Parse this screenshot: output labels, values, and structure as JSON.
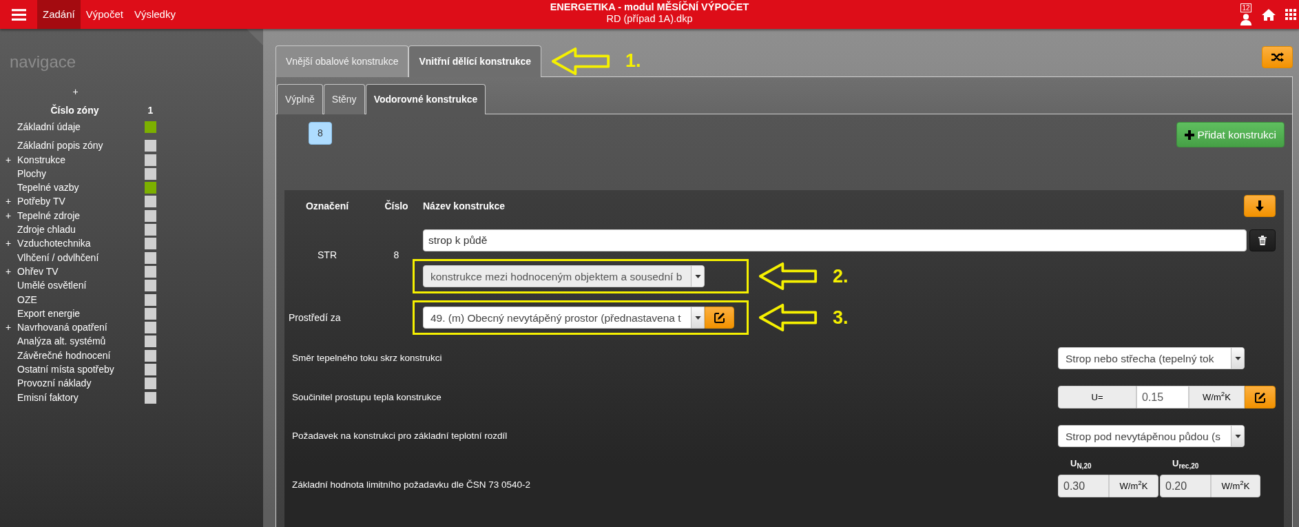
{
  "topbar": {
    "menu": [
      {
        "label": "Zadání",
        "selected": true
      },
      {
        "label": "Výpočet",
        "selected": false
      },
      {
        "label": "Výsledky",
        "selected": false
      }
    ],
    "title": "ENERGETIKA - modul MĚSÍČNÍ VÝPOČET",
    "subtitle": "RD (případ 1A).dkp",
    "notifications": "12"
  },
  "sidebar": {
    "title": "navigace",
    "add_zone": "+",
    "zone_label": "Číslo zóny",
    "zone_number": "1",
    "items": [
      {
        "label": "Základní údaje",
        "color": "#7cb000"
      },
      {
        "label": "Základní popis zóny",
        "color": "#d0d0d0"
      },
      {
        "prefix": "+",
        "label": "Konstrukce",
        "color": "#d0d0d0"
      },
      {
        "label": "Plochy",
        "color": "#d0d0d0"
      },
      {
        "label": "Tepelné vazby",
        "color": "#7cb000"
      },
      {
        "prefix": "+",
        "label": "Potřeby TV",
        "color": "#d0d0d0"
      },
      {
        "prefix": "+",
        "label": "Tepelné zdroje",
        "color": "#d0d0d0"
      },
      {
        "label": "Zdroje chladu",
        "color": "#d0d0d0"
      },
      {
        "prefix": "+",
        "label": "Vzduchotechnika",
        "color": "#d0d0d0"
      },
      {
        "label": "Vlhčení / odvlhčení",
        "color": "#d0d0d0"
      },
      {
        "prefix": "+",
        "label": "Ohřev TV",
        "color": "#d0d0d0"
      },
      {
        "label": "Umělé osvětlení",
        "color": "#d0d0d0"
      },
      {
        "label": "OZE",
        "color": "#d0d0d0"
      },
      {
        "label": "Export energie",
        "color": "#d0d0d0"
      },
      {
        "prefix": "+",
        "label": "Navrhovaná opatření",
        "color": "#d0d0d0"
      },
      {
        "label": "Analýza alt. systémů",
        "color": "#d0d0d0"
      },
      {
        "label": "Závěrečné hodnocení",
        "color": "#d0d0d0"
      },
      {
        "label": "Ostatní místa spotřeby",
        "color": "#d0d0d0"
      },
      {
        "label": "Provozní náklady",
        "color": "#d0d0d0"
      },
      {
        "label": "Emisní faktory",
        "color": "#d0d0d0"
      }
    ]
  },
  "outer_tabs": {
    "tabs": [
      {
        "label": "Vnější obalové konstrukce",
        "selected": false
      },
      {
        "label": "Vnitřní dělící konstrukce",
        "selected": true
      }
    ],
    "annotation": "1."
  },
  "inner_tabs": [
    {
      "label": "Výplně",
      "selected": false
    },
    {
      "label": "Stěny",
      "selected": false
    },
    {
      "label": "Vodorovné konstrukce",
      "selected": true
    }
  ],
  "construction_count": "8",
  "add_button": "Přidat konstrukci",
  "table": {
    "columns": [
      "Označení",
      "Číslo",
      "Název konstrukce"
    ],
    "code": "STR",
    "number": "8",
    "name": "strop k půdě",
    "type_select": {
      "value": "konstrukce mezi hodnoceným objektem a sousední b",
      "disabled": true,
      "annotation": "2."
    }
  },
  "environment": {
    "label": "Prostředí za",
    "value": "49. (m) Obecný nevytápěný prostor (přednastavena t",
    "disabled": false,
    "annotation": "3."
  },
  "rows": [
    {
      "kind": "select",
      "label": "Směr tepelného toku skrz konstrukci",
      "value": "Strop nebo střecha (tepelný tok"
    },
    {
      "kind": "u_value",
      "label": "Součinitel prostupu tepla konstrukce",
      "prefix": "U=",
      "value": "0.15",
      "unit": "W/m$^{2}$K"
    },
    {
      "kind": "select",
      "label": "Požadavek na konstrukci pro základní teplotní rozdíl",
      "value": "Strop pod nevytápěnou půdou (s"
    },
    {
      "kind": "limits",
      "label": "Základní hodnota limitního požadavku dle ČSN 73 0540-2",
      "fields": [
        {
          "label": "U$_{N,20}$",
          "value": "0.30",
          "unit": "W/m$^{2}$K"
        },
        {
          "label": "U$_{rec,20}$",
          "value": "0.20",
          "unit": "W/m$^{2}$K"
        }
      ]
    }
  ]
}
